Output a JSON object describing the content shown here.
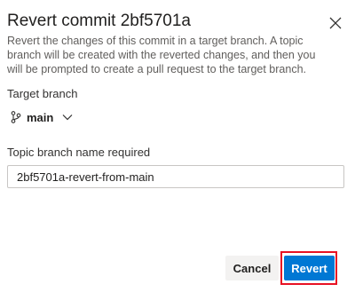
{
  "dialog": {
    "title": "Revert commit 2bf5701a",
    "description": "Revert the changes of this commit in a target branch. A topic branch will be created with the reverted changes, and then you will be prompted to create a pull request to the target branch.",
    "close_icon": "close-icon"
  },
  "target_branch": {
    "label": "Target branch",
    "icon": "branch-icon",
    "value": "main",
    "dropdown_icon": "chevron-down-icon"
  },
  "topic_branch": {
    "label": "Topic branch name required",
    "value": "2bf5701a-revert-from-main"
  },
  "buttons": {
    "cancel": "Cancel",
    "revert": "Revert"
  },
  "colors": {
    "primary": "#0078d4",
    "highlight": "#e81123"
  }
}
